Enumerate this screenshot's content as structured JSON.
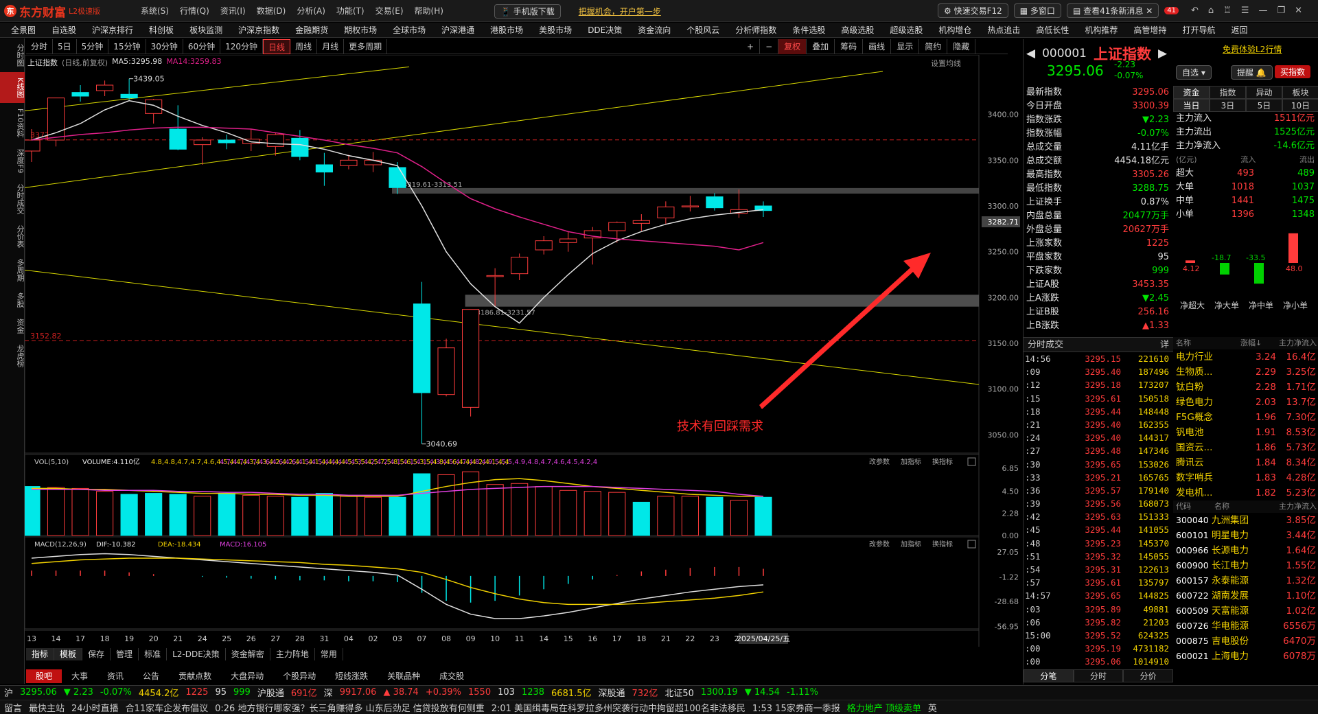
{
  "app": {
    "logo_mark": "东",
    "name": "东方财富",
    "edition": "L2极速版"
  },
  "sysmenu": [
    "系统(S)",
    "行情(Q)",
    "资讯(I)",
    "数据(D)",
    "分析(A)",
    "功能(T)",
    "交易(E)",
    "帮助(H)"
  ],
  "top_links": {
    "mobile": "手机版下载",
    "promo": "把握机会，开户第一步"
  },
  "top_right": {
    "fast_trade": "快速交易F12",
    "multi_window": "多窗口",
    "news": "查看41条新消息",
    "badge": "41"
  },
  "nav": [
    "全景图",
    "自选股",
    "沪深京排行",
    "科创板",
    "板块监测",
    "沪深京指数",
    "金融期货",
    "期权市场",
    "全球市场",
    "沪深港通",
    "港股市场",
    "美股市场",
    "DDE决策",
    "资金流向",
    "个股风云",
    "分析师指数",
    "条件选股",
    "高级选股",
    "超级选股",
    "机构增仓",
    "热点追击",
    "高低长性",
    "机构推荐",
    "高管增持",
    "打开导航",
    "返回"
  ],
  "rail": [
    "分时图",
    "K线图",
    "F10资料",
    "深度F9",
    "分时成交",
    "分价表",
    "多周期",
    "多股",
    "资金",
    "龙虎榜"
  ],
  "periods": [
    "分时",
    "5日",
    "5分钟",
    "15分钟",
    "30分钟",
    "60分钟",
    "120分钟",
    "日线",
    "周线",
    "月线",
    "更多周期"
  ],
  "tools": [
    "+",
    "−",
    "复权",
    "叠加",
    "筹码",
    "画线",
    "显示",
    "简约",
    "隐藏"
  ],
  "legend": {
    "name": "上证指数",
    "mode": "(日线,前复权)",
    "ma5": "MA5:3295.98",
    "ma14": "MA14:3259.83",
    "setting": "设置均线"
  },
  "chart_data": {
    "type": "candlestick",
    "dates": [
      "13",
      "14",
      "17",
      "18",
      "19",
      "20",
      "21",
      "24",
      "25",
      "26",
      "27",
      "28",
      "31",
      "01",
      "02",
      "03",
      "07",
      "08",
      "09",
      "10",
      "11",
      "14",
      "15",
      "16",
      "17",
      "18",
      "21",
      "22",
      "23",
      "24",
      "25"
    ],
    "x_labels": [
      "13",
      "14",
      "17",
      "18",
      "19",
      "20",
      "21",
      "24",
      "25",
      "26",
      "27",
      "28",
      "31",
      "04",
      "02",
      "03",
      "07",
      "08",
      "09",
      "10",
      "11",
      "14",
      "15",
      "16",
      "17",
      "18",
      "21",
      "22",
      "23",
      "24",
      "2025/04/25/五"
    ],
    "candles": [
      {
        "o": 3360,
        "h": 3384,
        "l": 3348,
        "c": 3372
      },
      {
        "o": 3372,
        "h": 3418,
        "l": 3365,
        "c": 3418
      },
      {
        "o": 3424,
        "h": 3432,
        "l": 3414,
        "c": 3420
      },
      {
        "o": 3426,
        "h": 3437,
        "l": 3420,
        "c": 3432
      },
      {
        "o": 3422,
        "h": 3439,
        "l": 3416,
        "c": 3418
      },
      {
        "o": 3401,
        "h": 3417,
        "l": 3390,
        "c": 3416
      },
      {
        "o": 3384,
        "h": 3410,
        "l": 3361,
        "c": 3362
      },
      {
        "o": 3367,
        "h": 3375,
        "l": 3345,
        "c": 3372
      },
      {
        "o": 3372,
        "h": 3378,
        "l": 3362,
        "c": 3369
      },
      {
        "o": 3368,
        "h": 3384,
        "l": 3360,
        "c": 3373
      },
      {
        "o": 3365,
        "h": 3380,
        "l": 3355,
        "c": 3378
      },
      {
        "o": 3374,
        "h": 3383,
        "l": 3350,
        "c": 3354
      },
      {
        "o": 3345,
        "h": 3358,
        "l": 3322,
        "c": 3337
      },
      {
        "o": 3344,
        "h": 3356,
        "l": 3340,
        "c": 3350
      },
      {
        "o": 3345,
        "h": 3359,
        "l": 3337,
        "c": 3350
      },
      {
        "o": 3342,
        "h": 3348,
        "l": 3313,
        "c": 3320
      },
      {
        "o": 3193,
        "h": 3217,
        "l": 3040,
        "c": 3096
      },
      {
        "o": 3094,
        "h": 3155,
        "l": 3092,
        "c": 3145
      },
      {
        "o": 3080,
        "h": 3187,
        "l": 3070,
        "c": 3187
      },
      {
        "o": 3223,
        "h": 3232,
        "l": 3190,
        "c": 3224
      },
      {
        "o": 3226,
        "h": 3248,
        "l": 3219,
        "c": 3244
      },
      {
        "o": 3252,
        "h": 3267,
        "l": 3247,
        "c": 3262
      },
      {
        "o": 3260,
        "h": 3272,
        "l": 3250,
        "c": 3264
      },
      {
        "o": 3265,
        "h": 3277,
        "l": 3236,
        "c": 3273
      },
      {
        "o": 3273,
        "h": 3283,
        "l": 3260,
        "c": 3282
      },
      {
        "o": 3281,
        "h": 3291,
        "l": 3273,
        "c": 3284
      },
      {
        "o": 3287,
        "h": 3305,
        "l": 3280,
        "c": 3299
      },
      {
        "o": 3300,
        "h": 3311,
        "l": 3294,
        "c": 3300
      },
      {
        "o": 3310,
        "h": 3314,
        "l": 3295,
        "c": 3298
      },
      {
        "o": 3292,
        "h": 3318,
        "l": 3287,
        "c": 3296
      },
      {
        "o": 3300,
        "h": 3305,
        "l": 3288,
        "c": 3295
      }
    ],
    "ma5": [
      3372,
      3380,
      3390,
      3405,
      3415,
      3410,
      3398,
      3388,
      3380,
      3370,
      3368,
      3367,
      3362,
      3355,
      3350,
      3344,
      3300,
      3250,
      3215,
      3190,
      3172,
      3200,
      3225,
      3248,
      3262,
      3272,
      3280,
      3286,
      3290,
      3293,
      3296
    ],
    "ma14": [
      3372,
      3375,
      3378,
      3380,
      3383,
      3385,
      3386,
      3386,
      3385,
      3384,
      3380,
      3376,
      3372,
      3367,
      3363,
      3358,
      3343,
      3325,
      3308,
      3297,
      3288,
      3280,
      3272,
      3267,
      3264,
      3262,
      3260,
      3258,
      3256,
      3252,
      3260
    ],
    "ylim": [
      3030,
      3450
    ],
    "y_ticks": [
      "3400.00",
      "3350.00",
      "3300.00",
      "3250.00",
      "3200.00",
      "3150.00",
      "3100.00",
      "3050.00"
    ],
    "annotations": {
      "high": "3439.05",
      "low": "3040.69",
      "band_upper": "3319.61-3313.51",
      "band_lower": "3186.81-3231.57",
      "level_a": "3372.19",
      "level_b": "3152.82",
      "last": "3282.71",
      "note": "技术有回踩需求"
    },
    "volume": {
      "legend": "VOL(5,10)",
      "volume": "VOLUME:4.110亿",
      "mavol1": [
        4.8,
        4.8,
        4.7,
        4.7,
        4.6,
        4.5,
        4.4,
        4.3,
        4.3,
        4.2,
        4.2,
        4.1,
        4.1,
        4.0,
        4.0,
        4.0,
        4.5,
        5.0,
        5.4,
        5.7,
        5.8,
        5.6,
        5.3,
        5.0,
        4.8,
        4.6,
        4.4,
        4.2,
        4.1,
        4.0,
        4.0
      ],
      "mavol2": [
        4.7,
        4.7,
        4.7,
        4.6,
        4.6,
        4.6,
        4.5,
        4.5,
        4.4,
        4.4,
        4.3,
        4.2,
        4.2,
        4.1,
        4.1,
        4.1,
        4.3,
        4.5,
        4.7,
        4.8,
        4.9,
        5.0,
        5.0,
        5.0,
        4.9,
        4.8,
        4.7,
        4.6,
        4.5,
        4.2,
        4.0
      ],
      "values": [
        5.0,
        4.9,
        4.8,
        4.5,
        4.2,
        4.3,
        4.2,
        4.0,
        4.3,
        4.1,
        4.0,
        3.9,
        4.3,
        4.0,
        3.9,
        3.9,
        6.3,
        6.2,
        6.5,
        5.2,
        5.3,
        5.0,
        4.6,
        4.5,
        4.4,
        3.4,
        4.0,
        4.0,
        3.9,
        3.6,
        3.9
      ],
      "up": [
        false,
        true,
        true,
        true,
        false,
        false,
        false,
        true,
        false,
        true,
        true,
        false,
        false,
        true,
        true,
        false,
        false,
        true,
        true,
        true,
        true,
        true,
        true,
        true,
        true,
        false,
        true,
        true,
        false,
        true,
        false
      ],
      "ylim": [
        0,
        7
      ],
      "y_ticks": [
        "6.85",
        "4.50",
        "2.28",
        "0.00"
      ]
    },
    "macd": {
      "legend": "MACD(12,26,9)",
      "dif": "DIF:-10.382",
      "dea": "DEA:-18.434",
      "macd": "MACD:16.105",
      "dif_values": [
        20,
        22,
        24,
        25,
        24,
        22,
        20,
        18,
        16,
        14,
        12,
        10,
        8,
        6,
        4,
        1,
        -15,
        -32,
        -43,
        -48,
        -48,
        -45,
        -41,
        -36,
        -31,
        -26,
        -22,
        -18,
        -15,
        -12,
        -10
      ],
      "dea_values": [
        14,
        16,
        18,
        19,
        20,
        20,
        20,
        19,
        18,
        17,
        16,
        15,
        13,
        12,
        10,
        8,
        4,
        -4,
        -13,
        -20,
        -26,
        -30,
        -32,
        -32,
        -32,
        -31,
        -29,
        -27,
        -25,
        -22,
        -18
      ],
      "hist": [
        6,
        6,
        6,
        6,
        4,
        2,
        0,
        -1,
        -2,
        -3,
        -4,
        -5,
        -5,
        -6,
        -6,
        -7,
        -19,
        -28,
        -30,
        -28,
        -22,
        -15,
        -9,
        -4,
        1,
        5,
        7,
        9,
        10,
        10,
        8
      ],
      "ylim": [
        -58,
        30
      ],
      "y_ticks": [
        "27.05",
        "-1.22",
        "-28.68",
        "-56.95"
      ]
    },
    "panel_buttons": [
      "改参数",
      "加指标",
      "换指标"
    ]
  },
  "quote": {
    "code": "000001",
    "name": "上证指数",
    "price": "3295.06",
    "change": "-2.23",
    "pct": "-0.07%",
    "watch": "自选",
    "alert": "提醒",
    "buy": "买指数",
    "l2": "免费体验L2行情"
  },
  "stats": [
    {
      "k": "最新指数",
      "v": "3295.06",
      "c": "red"
    },
    {
      "k": "今日开盘",
      "v": "3300.39",
      "c": "red"
    },
    {
      "k": "指数涨跌",
      "v": "▼2.23",
      "c": "green"
    },
    {
      "k": "指数涨幅",
      "v": "-0.07%",
      "c": "green"
    },
    {
      "k": "总成交量",
      "v": "4.11亿手",
      "c": "white"
    },
    {
      "k": "总成交额",
      "v": "4454.18亿元",
      "c": "white"
    },
    {
      "k": "最高指数",
      "v": "3305.26",
      "c": "red"
    },
    {
      "k": "最低指数",
      "v": "3288.75",
      "c": "green"
    },
    {
      "k": "上证换手",
      "v": "0.87%",
      "c": "white"
    },
    {
      "k": "内盘总量",
      "v": "20477万手",
      "c": "green"
    },
    {
      "k": "外盘总量",
      "v": "20627万手",
      "c": "red"
    },
    {
      "k": "上涨家数",
      "v": "1225",
      "c": "red"
    },
    {
      "k": "平盘家数",
      "v": "95",
      "c": "white"
    },
    {
      "k": "下跌家数",
      "v": "999",
      "c": "green"
    },
    {
      "k": "上证A股",
      "v": "3453.35",
      "c": "red"
    },
    {
      "k": "上A涨跌",
      "v": "▼2.45",
      "c": "green"
    },
    {
      "k": "上证B股",
      "v": "256.16",
      "c": "red"
    },
    {
      "k": "上B涨跌",
      "v": "▲1.33",
      "c": "red"
    }
  ],
  "flow": {
    "tabs1": [
      "资金",
      "指数",
      "异动",
      "板块"
    ],
    "tabs2": [
      "当日",
      "3日",
      "5日",
      "10日"
    ],
    "rows": [
      {
        "k": "主力流入",
        "v": "1511亿元",
        "c": "red"
      },
      {
        "k": "主力流出",
        "v": "1525亿元",
        "c": "green"
      },
      {
        "k": "主力净流入",
        "v": "-14.6亿元",
        "c": "green"
      }
    ],
    "unit": "(亿元)",
    "in": "流入",
    "out": "流出",
    "sizes": [
      {
        "k": "超大",
        "i": "493",
        "o": "489"
      },
      {
        "k": "大单",
        "i": "1018",
        "o": "1037"
      },
      {
        "k": "中单",
        "i": "1441",
        "o": "1475"
      },
      {
        "k": "小单",
        "i": "1396",
        "o": "1348"
      }
    ],
    "net": [
      4.12,
      -18.7,
      -33.5,
      48.0
    ],
    "net_labels": [
      "4.12",
      "-18.7",
      "-33.5",
      "48.0"
    ],
    "net_names": [
      "净超大",
      "净大单",
      "净中单",
      "净小单"
    ]
  },
  "ticks_title": "分时成交",
  "ticks_detail": "详",
  "ticks": [
    {
      "t": "14:56",
      "p": "3295.15",
      "v": "221610"
    },
    {
      "t": ":09",
      "p": "3295.40",
      "v": "187496"
    },
    {
      "t": ":12",
      "p": "3295.18",
      "v": "173207"
    },
    {
      "t": ":15",
      "p": "3295.61",
      "v": "150518"
    },
    {
      "t": ":18",
      "p": "3295.44",
      "v": "148448"
    },
    {
      "t": ":21",
      "p": "3295.40",
      "v": "162355"
    },
    {
      "t": ":24",
      "p": "3295.40",
      "v": "144317"
    },
    {
      "t": ":27",
      "p": "3295.48",
      "v": "147346"
    },
    {
      "t": ":30",
      "p": "3295.65",
      "v": "153026"
    },
    {
      "t": ":33",
      "p": "3295.21",
      "v": "165765"
    },
    {
      "t": ":36",
      "p": "3295.57",
      "v": "179140"
    },
    {
      "t": ":39",
      "p": "3295.56",
      "v": "168073"
    },
    {
      "t": ":42",
      "p": "3295.63",
      "v": "151333"
    },
    {
      "t": ":45",
      "p": "3295.44",
      "v": "141055"
    },
    {
      "t": ":48",
      "p": "3295.23",
      "v": "145370"
    },
    {
      "t": ":51",
      "p": "3295.32",
      "v": "145055"
    },
    {
      "t": ":54",
      "p": "3295.31",
      "v": "122613"
    },
    {
      "t": ":57",
      "p": "3295.61",
      "v": "135797"
    },
    {
      "t": "14:57",
      "p": "3295.65",
      "v": "144825"
    },
    {
      "t": ":03",
      "p": "3295.89",
      "v": "49881"
    },
    {
      "t": ":06",
      "p": "3295.82",
      "v": "21203"
    },
    {
      "t": "15:00",
      "p": "3295.52",
      "v": "624325"
    },
    {
      "t": ":00",
      "p": "3295.19",
      "v": "4731182"
    },
    {
      "t": ":00",
      "p": "3295.06",
      "v": "1014910"
    }
  ],
  "sector_head": {
    "a": "名称",
    "b": "涨幅↓",
    "c": "主力净流入"
  },
  "sectors": [
    {
      "a": "电力行业",
      "b": "3.24",
      "c": "16.4亿"
    },
    {
      "a": "生物质...",
      "b": "2.29",
      "c": "3.25亿"
    },
    {
      "a": "钛白粉",
      "b": "2.28",
      "c": "1.71亿"
    },
    {
      "a": "绿色电力",
      "b": "2.03",
      "c": "13.7亿"
    },
    {
      "a": "F5G概念",
      "b": "1.96",
      "c": "7.30亿"
    },
    {
      "a": "钒电池",
      "b": "1.91",
      "c": "8.53亿"
    },
    {
      "a": "国资云...",
      "b": "1.86",
      "c": "5.73亿"
    },
    {
      "a": "腾讯云",
      "b": "1.84",
      "c": "8.34亿"
    },
    {
      "a": "数字哨兵",
      "b": "1.83",
      "c": "4.28亿"
    },
    {
      "a": "发电机...",
      "b": "1.82",
      "c": "5.23亿"
    }
  ],
  "stock_head": {
    "a": "代码",
    "b": "名称",
    "c": "主力净流入"
  },
  "stocks": [
    {
      "a": "300040",
      "b": "九洲集团",
      "c": "3.85亿"
    },
    {
      "a": "600101",
      "b": "明星电力",
      "c": "3.44亿"
    },
    {
      "a": "000966",
      "b": "长源电力",
      "c": "1.64亿"
    },
    {
      "a": "600900",
      "b": "长江电力",
      "c": "1.55亿"
    },
    {
      "a": "600157",
      "b": "永泰能源",
      "c": "1.32亿"
    },
    {
      "a": "600722",
      "b": "湖南发展",
      "c": "1.10亿"
    },
    {
      "a": "600509",
      "b": "天富能源",
      "c": "1.02亿"
    },
    {
      "a": "600726",
      "b": "华电能源",
      "c": "6556万"
    },
    {
      "a": "000875",
      "b": "吉电股份",
      "c": "6470万"
    },
    {
      "a": "600021",
      "b": "上海电力",
      "c": "6078万"
    }
  ],
  "right_bottom_tabs": [
    "分笔",
    "分时",
    "分价"
  ],
  "bottom_tabs1": [
    "指标",
    "模板",
    "保存",
    "管理",
    "标准",
    "L2-DDE决策",
    "资金解密",
    "主力阵地",
    "常用"
  ],
  "bottom_tabs2": [
    "股吧",
    "大事",
    "资讯",
    "公告",
    "贡献点数",
    "大盘异动",
    "个股异动",
    "短线涨跌",
    "关联品种",
    "成交股"
  ],
  "status": {
    "sh": "沪",
    "sh_price": "3295.06",
    "sh_chg": "▼ 2.23",
    "sh_pct": "-0.07%",
    "sh_amt": "4454.2亿",
    "sh_up": "1225",
    "sh_flat": "95",
    "sh_down": "999",
    "hgt": "沪股通",
    "hgt_v": "691亿",
    "sz": "深",
    "sz_price": "9917.06",
    "sz_chg": "▲ 38.74",
    "sz_pct": "+0.39%",
    "sz_up": "1550",
    "sz_flat": "103",
    "sz_down": "1238",
    "sz_amt": "6681.5亿",
    "sgt": "深股通",
    "sgt_v": "732亿",
    "bz": "北证50",
    "bz_price": "1300.19",
    "bz_chg": "▼ 14.54",
    "bz_pct": "-1.11%"
  },
  "news": [
    "留言",
    "最快主站",
    "24小时直播",
    "合11家车企发布倡议",
    "0:26 地方银行哪家强？长三角赚得多 山东后劲足 信贷投放有何侧重",
    "2:01 美国缉毒局在科罗拉多州突袭行动中拘留超100名非法移民",
    "1:53 15家券商一季报",
    "格力地产 顶级卖单",
    "英"
  ]
}
